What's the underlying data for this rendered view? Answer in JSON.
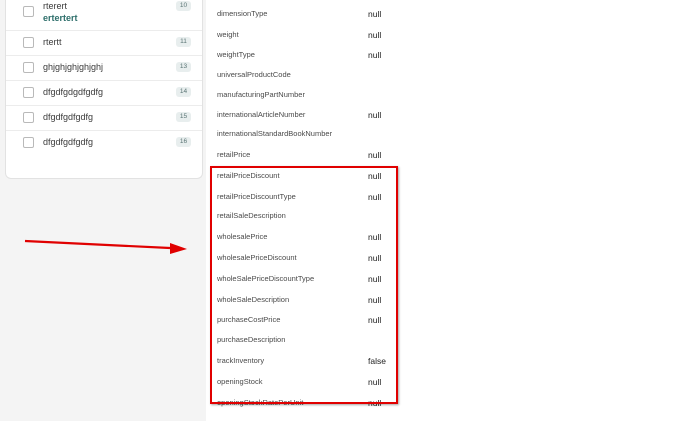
{
  "list": {
    "items": [
      {
        "label": "rterert",
        "sub": "ertertert",
        "badge": "10"
      },
      {
        "label": "rtertt",
        "badge": "11"
      },
      {
        "label": "ghjghjghjghjghj",
        "badge": "13"
      },
      {
        "label": "dfgdfgdgdfgdfg",
        "badge": "14"
      },
      {
        "label": "dfgdfgdfgdfg",
        "badge": "15"
      },
      {
        "label": "dfgdfgdfgdfg",
        "badge": "16"
      }
    ]
  },
  "properties": [
    {
      "key": "dimensionType",
      "value": "null"
    },
    {
      "key": "weight",
      "value": "null"
    },
    {
      "key": "weightType",
      "value": "null"
    },
    {
      "key": "universalProductCode",
      "value": ""
    },
    {
      "key": "manufacturingPartNumber",
      "value": ""
    },
    {
      "key": "internationalArticleNumber",
      "value": "null"
    },
    {
      "key": "internationalStandardBookNumber",
      "value": ""
    },
    {
      "key": "retailPrice",
      "value": "null"
    },
    {
      "key": "retailPriceDiscount",
      "value": "null"
    },
    {
      "key": "retailPriceDiscountType",
      "value": "null"
    },
    {
      "key": "retailSaleDescription",
      "value": ""
    },
    {
      "key": "wholesalePrice",
      "value": "null"
    },
    {
      "key": "wholesalePriceDiscount",
      "value": "null"
    },
    {
      "key": "wholeSalePriceDiscountType",
      "value": "null"
    },
    {
      "key": "wholeSaleDescription",
      "value": "null"
    },
    {
      "key": "purchaseCostPrice",
      "value": "null"
    },
    {
      "key": "purchaseDescription",
      "value": ""
    },
    {
      "key": "trackInventory",
      "value": "false"
    },
    {
      "key": "openingStock",
      "value": "null"
    },
    {
      "key": "openingStockRatePerUnit",
      "value": "null"
    }
  ],
  "annotation": {
    "color": "#e00000"
  }
}
